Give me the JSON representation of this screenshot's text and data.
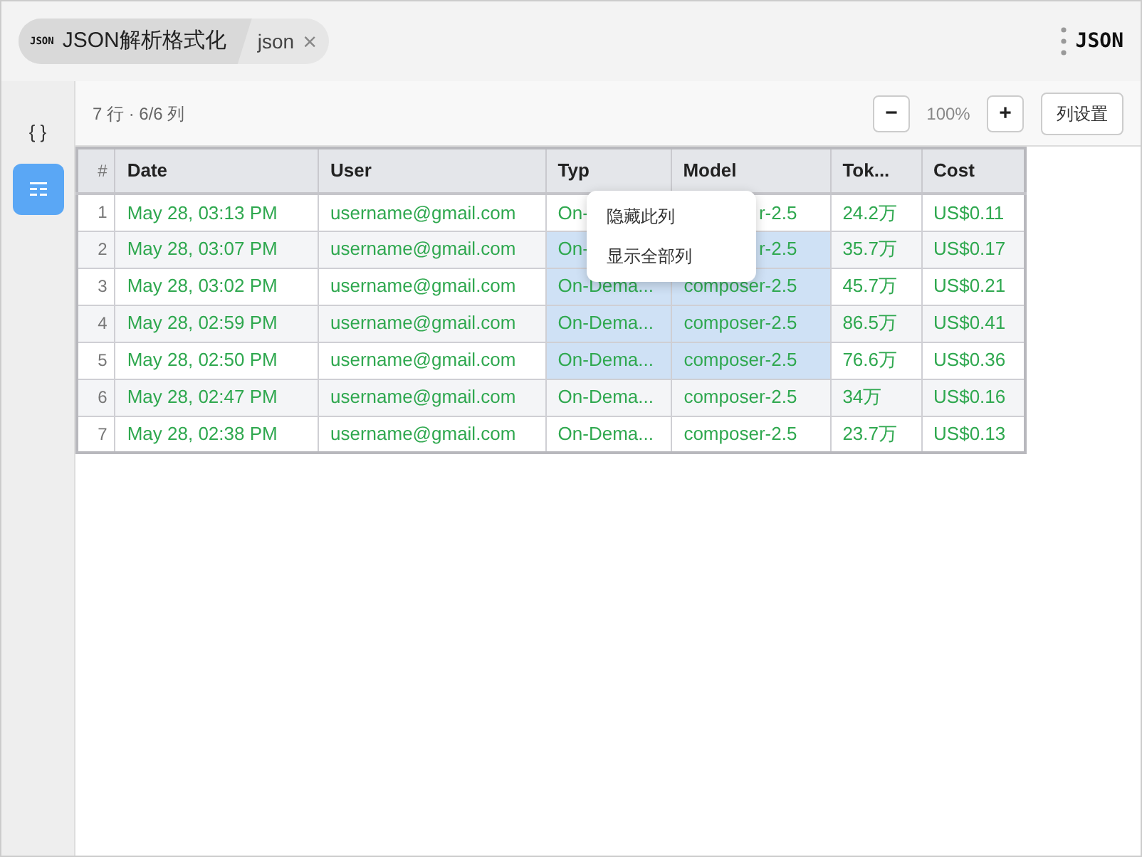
{
  "tab": {
    "logo": "JSON",
    "title": "JSON解析格式化",
    "subtitle": "json",
    "close": "×"
  },
  "brand": {
    "logo": "JSON"
  },
  "sidebar": {
    "items": [
      {
        "kind": "braces",
        "label": "{ }",
        "selected": false
      },
      {
        "kind": "table",
        "selected": true
      }
    ]
  },
  "toolbar": {
    "summary": "7 行 · 6/6 列",
    "zoom_out": "−",
    "zoom": "100%",
    "zoom_in": "+",
    "column_settings": "列设置"
  },
  "table": {
    "columns": [
      "#",
      "Date",
      "User",
      "Typ",
      "Model",
      "Tok...",
      "Cost"
    ],
    "rows": [
      {
        "cells": [
          "1",
          "May 28, 03:13 PM",
          "username@gmail.com",
          "On-",
          "r-2.5",
          "24.2万",
          "US$0.11"
        ],
        "selected": [
          false,
          false,
          false,
          false,
          false,
          false,
          false
        ]
      },
      {
        "cells": [
          "2",
          "May 28, 03:07 PM",
          "username@gmail.com",
          "On-",
          "r-2.5",
          "35.7万",
          "US$0.17"
        ],
        "selected": [
          false,
          false,
          false,
          true,
          true,
          false,
          false
        ]
      },
      {
        "cells": [
          "3",
          "May 28, 03:02 PM",
          "username@gmail.com",
          "On-Dema...",
          "composer-2.5",
          "45.7万",
          "US$0.21"
        ],
        "selected": [
          false,
          false,
          false,
          true,
          true,
          false,
          false
        ]
      },
      {
        "cells": [
          "4",
          "May 28, 02:59 PM",
          "username@gmail.com",
          "On-Dema...",
          "composer-2.5",
          "86.5万",
          "US$0.41"
        ],
        "selected": [
          false,
          false,
          false,
          true,
          true,
          false,
          false
        ]
      },
      {
        "cells": [
          "5",
          "May 28, 02:50 PM",
          "username@gmail.com",
          "On-Dema...",
          "composer-2.5",
          "76.6万",
          "US$0.36"
        ],
        "selected": [
          false,
          false,
          false,
          true,
          true,
          false,
          false
        ]
      },
      {
        "cells": [
          "6",
          "May 28, 02:47 PM",
          "username@gmail.com",
          "On-Dema...",
          "composer-2.5",
          "34万",
          "US$0.16"
        ],
        "selected": [
          false,
          false,
          false,
          false,
          false,
          false,
          false
        ]
      },
      {
        "cells": [
          "7",
          "May 28, 02:38 PM",
          "username@gmail.com",
          "On-Dema...",
          "composer-2.5",
          "23.7万",
          "US$0.13"
        ],
        "selected": [
          false,
          false,
          false,
          false,
          false,
          false,
          false
        ]
      }
    ]
  },
  "context_menu": {
    "items": [
      "隐藏此列",
      "显示全部列"
    ]
  }
}
